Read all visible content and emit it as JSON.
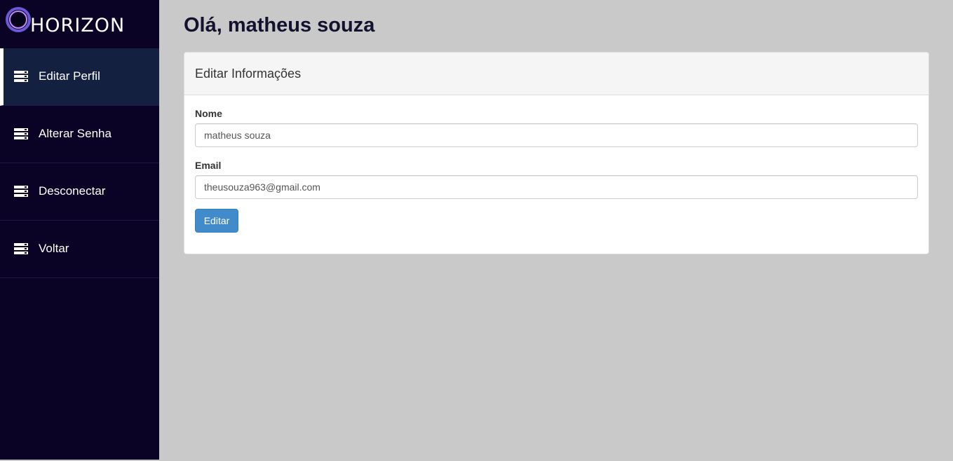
{
  "brand": {
    "name": "HORIZON"
  },
  "sidebar": {
    "items": [
      {
        "label": "Editar Perfil",
        "icon": "list-icon",
        "active": true
      },
      {
        "label": "Alterar Senha",
        "icon": "list-icon",
        "active": false
      },
      {
        "label": "Desconectar",
        "icon": "list-icon",
        "active": false
      },
      {
        "label": "Voltar",
        "icon": "list-icon",
        "active": false
      }
    ]
  },
  "main": {
    "greeting": "Olá, matheus souza",
    "panel": {
      "title": "Editar Informações",
      "fields": [
        {
          "label": "Nome",
          "value": "matheus souza"
        },
        {
          "label": "Email",
          "value": "theusouza963@gmail.com"
        }
      ],
      "submit_label": "Editar"
    }
  },
  "colors": {
    "sidebar_bg": "#0a0326",
    "sidebar_active_bg": "#132040",
    "page_bg": "#c9c9c9",
    "primary": "#428bca"
  }
}
